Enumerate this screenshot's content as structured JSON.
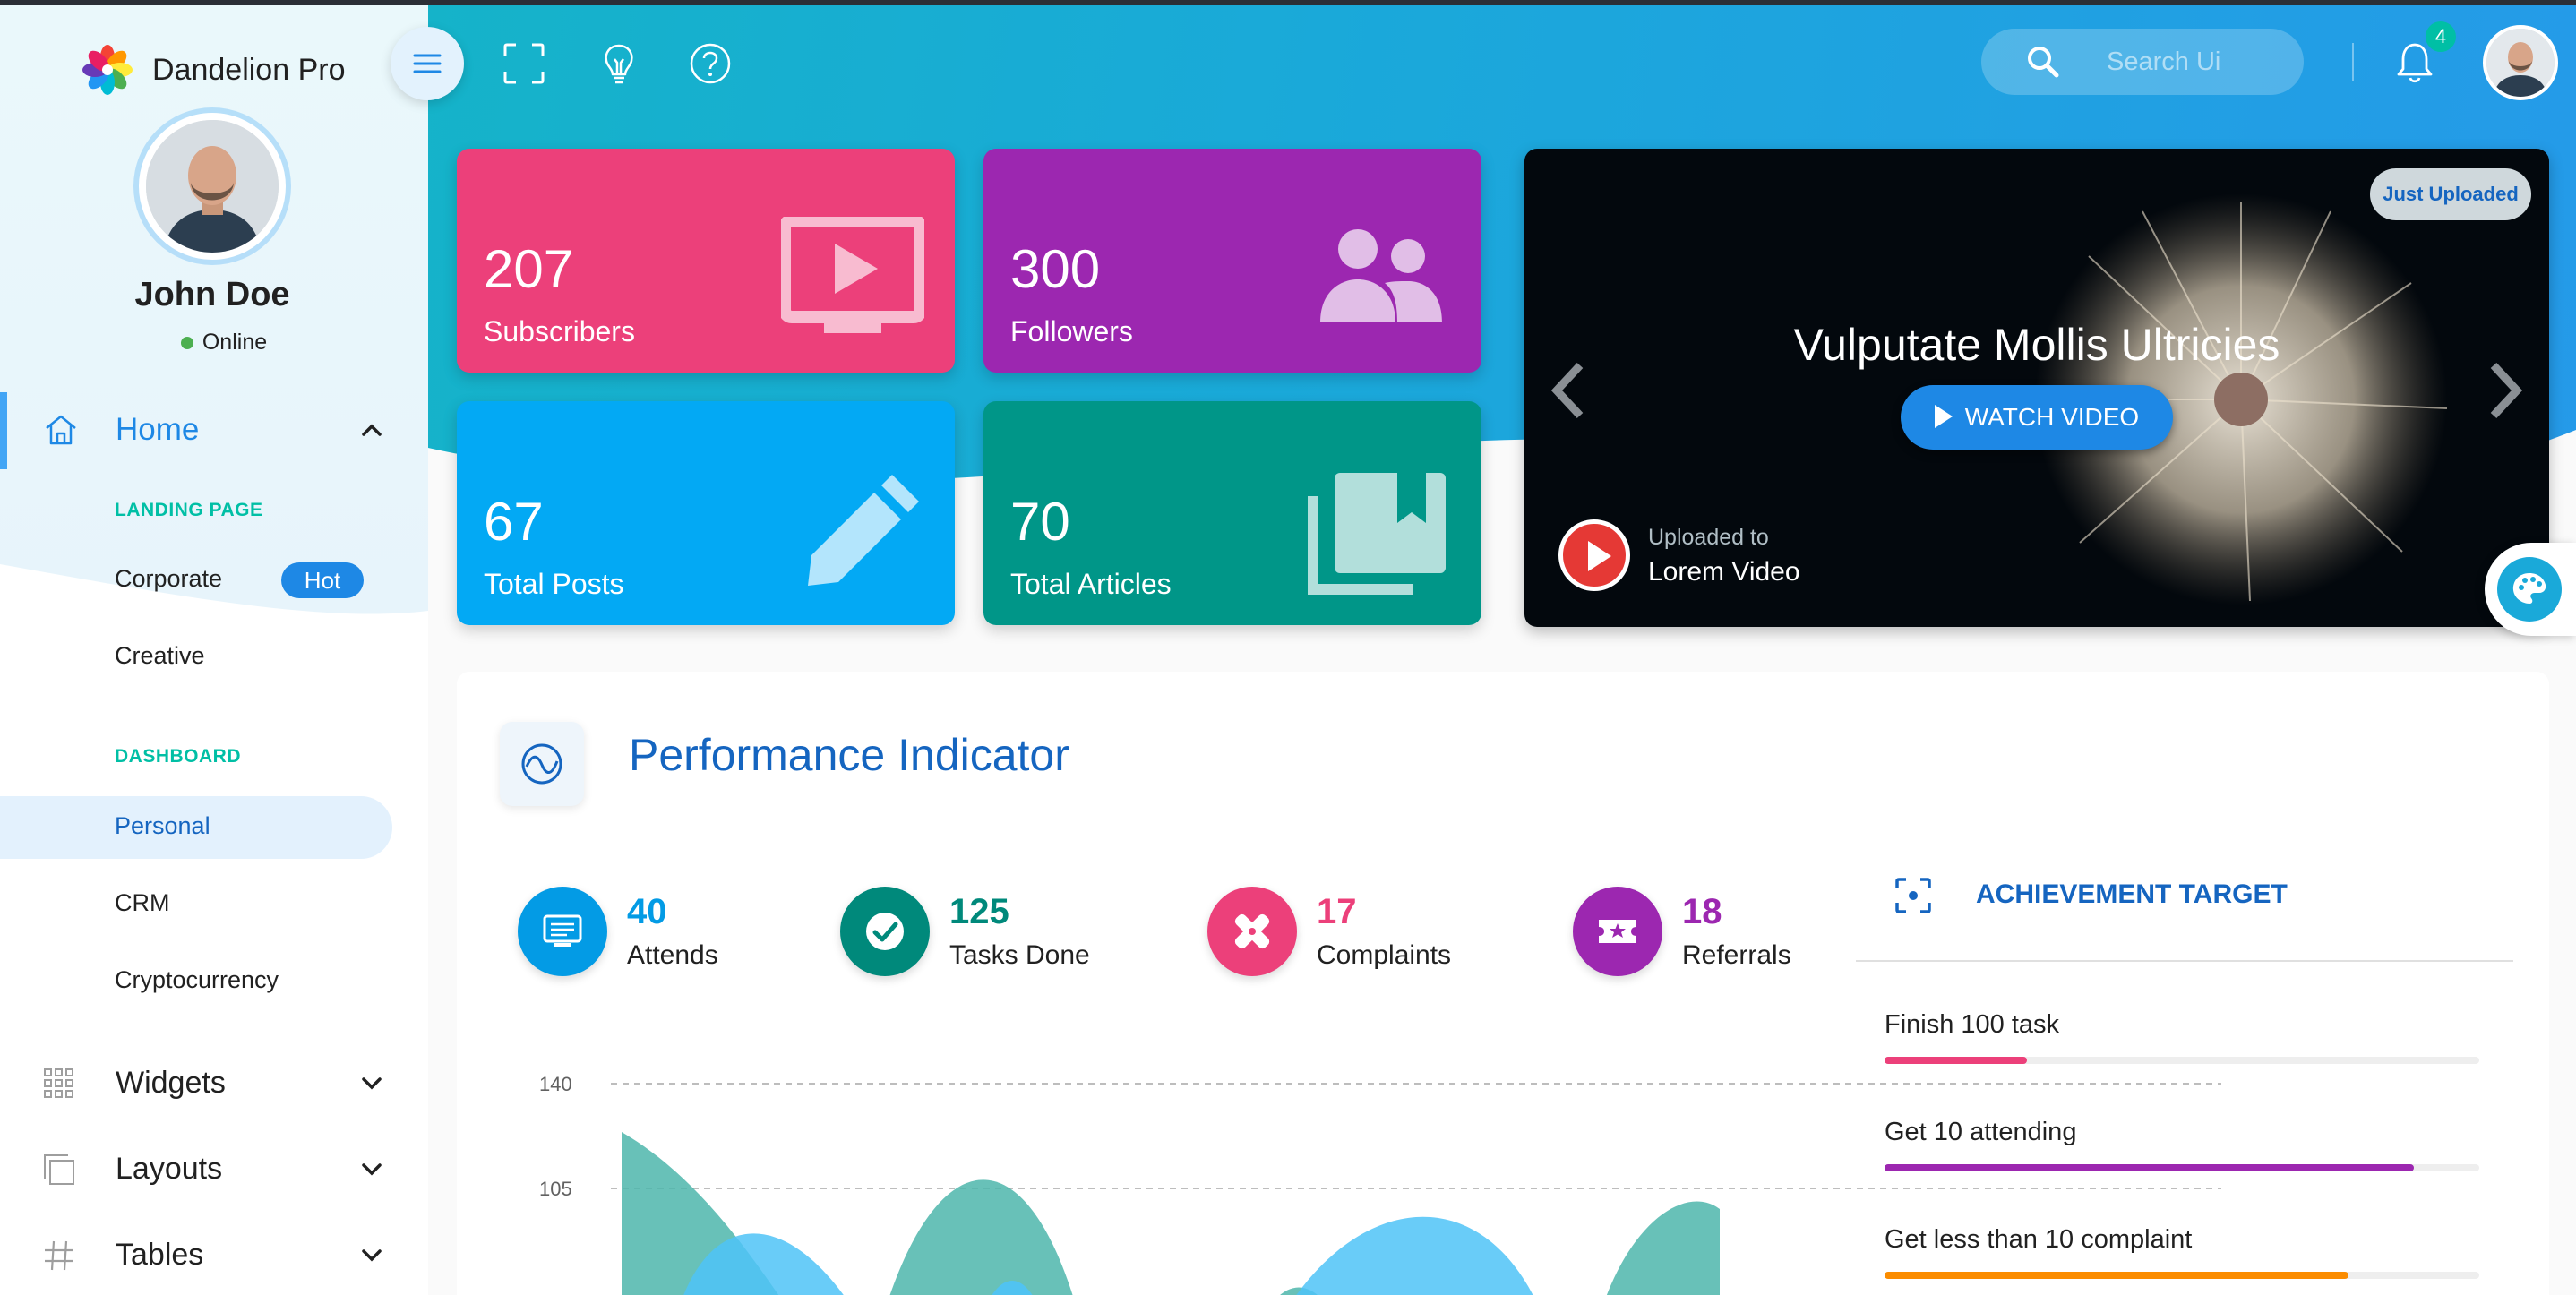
{
  "app": {
    "name": "Dandelion Pro"
  },
  "user": {
    "name": "John Doe",
    "status": "Online"
  },
  "sidebar": {
    "home": {
      "label": "Home"
    },
    "groups": [
      {
        "title": "LANDING PAGE",
        "items": [
          {
            "label": "Corporate",
            "badge": "Hot"
          },
          {
            "label": "Creative"
          }
        ]
      },
      {
        "title": "DASHBOARD",
        "items": [
          {
            "label": "Personal",
            "active": true
          },
          {
            "label": "CRM"
          },
          {
            "label": "Cryptocurrency"
          }
        ]
      }
    ],
    "main": [
      {
        "label": "Widgets",
        "icon": "grid-icon"
      },
      {
        "label": "Layouts",
        "icon": "layouts-icon"
      },
      {
        "label": "Tables",
        "icon": "hash-icon"
      }
    ]
  },
  "header": {
    "search_placeholder": "Search Ui",
    "notification_count": "4"
  },
  "stats": [
    {
      "value": "207",
      "label": "Subscribers",
      "color": "#ec407a",
      "icon": "tv-play-icon"
    },
    {
      "value": "300",
      "label": "Followers",
      "color": "#9c27b0",
      "icon": "people-icon"
    },
    {
      "value": "67",
      "label": "Total Posts",
      "color": "#03a9f4",
      "icon": "pencil-icon"
    },
    {
      "value": "70",
      "label": "Total Articles",
      "color": "#009688",
      "icon": "library-books-icon"
    }
  ],
  "video": {
    "badge": "Just Uploaded",
    "title": "Vulputate Mollis Ultricies",
    "button": "WATCH VIDEO",
    "uploaded_to_label": "Uploaded to",
    "uploaded_to_name": "Lorem Video"
  },
  "performance": {
    "title": "Performance Indicator",
    "counters": [
      {
        "value": "40",
        "label": "Attends",
        "color": "#039be5",
        "icon": "screen-icon"
      },
      {
        "value": "125",
        "label": "Tasks Done",
        "color": "#00897b",
        "icon": "check-circle-icon"
      },
      {
        "value": "17",
        "label": "Complaints",
        "color": "#ec407a",
        "icon": "bandage-icon"
      },
      {
        "value": "18",
        "label": "Referrals",
        "color": "#9c27b0",
        "icon": "ticket-icon"
      }
    ],
    "achievement": {
      "title": "ACHIEVEMENT TARGET",
      "tasks": [
        {
          "label": "Finish 100 task",
          "progress": 0.24,
          "color": "#ec407a"
        },
        {
          "label": "Get 10 attending",
          "progress": 0.89,
          "color": "#9c27b0"
        },
        {
          "label": "Get less than 10 complaint",
          "progress": 0.78,
          "color": "#fb8c00"
        }
      ]
    },
    "chart_data": {
      "type": "area",
      "y_ticks": [
        "140",
        "105"
      ],
      "colors": [
        "#4db6ac",
        "#4fc3f7"
      ]
    }
  }
}
